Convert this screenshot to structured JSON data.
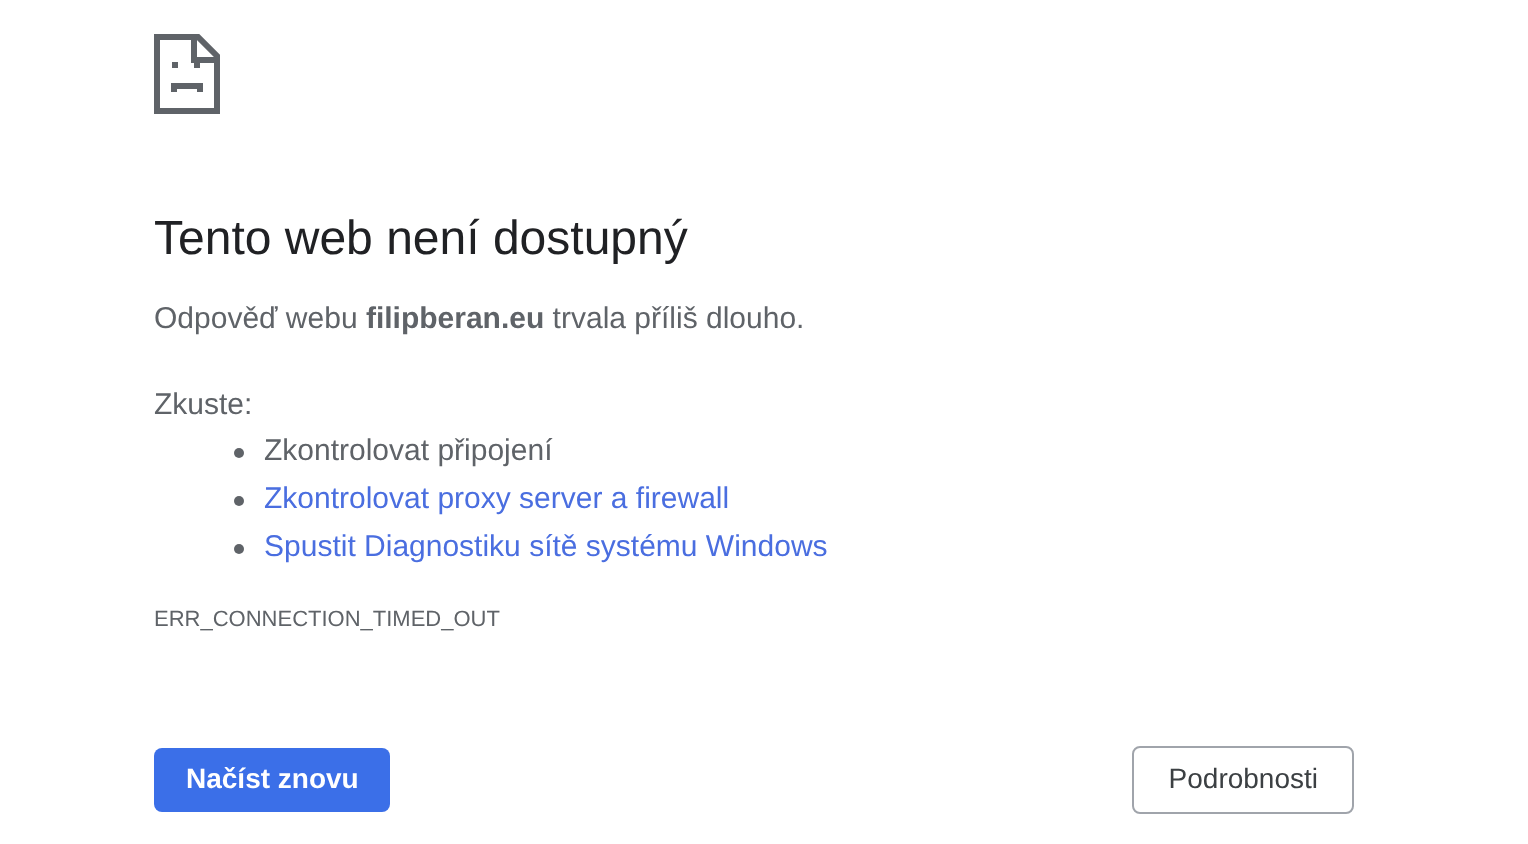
{
  "heading": "Tento web není dostupný",
  "message": "Odpověď webu **filipberan.eu** trvala příliš dlouho.",
  "try_label": "Zkuste:",
  "suggestions": [
    {
      "kind": "text",
      "label": "Zkontrolovat připojení"
    },
    {
      "kind": "link",
      "label": "Zkontrolovat proxy server a firewall"
    },
    {
      "kind": "link",
      "label": "Spustit Diagnostiku sítě systému Windows"
    }
  ],
  "error_code": "ERR_CONNECTION_TIMED_OUT",
  "buttons": [
    {
      "kind": "primary",
      "label": "Načíst znovu"
    },
    {
      "kind": "secondary",
      "label": "Podrobnosti"
    }
  ]
}
